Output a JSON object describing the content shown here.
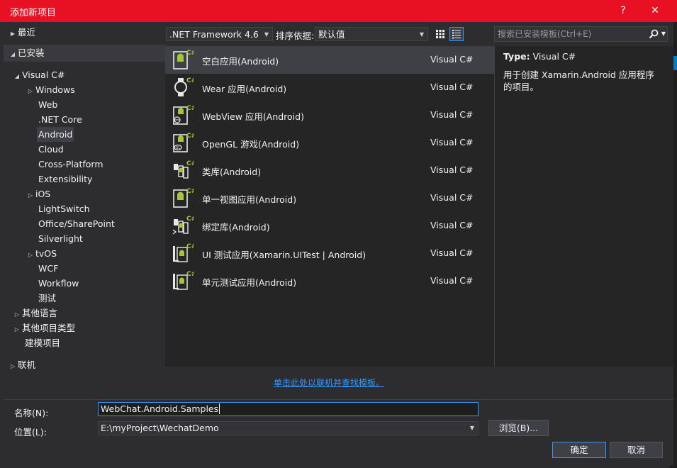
{
  "window": {
    "title": "添加新项目",
    "help_label": "?",
    "close_label": "✕"
  },
  "sidebar": {
    "recent": "最近",
    "installed": "已安装",
    "online": "联机",
    "visual_cs": "Visual C#",
    "items": [
      "Windows",
      "Web",
      ".NET Core",
      "Android",
      "Cloud",
      "Cross-Platform",
      "Extensibility",
      "iOS",
      "LightSwitch",
      "Office/SharePoint",
      "Silverlight",
      "tvOS",
      "WCF",
      "Workflow",
      "测试"
    ],
    "other_languages": "其他语言",
    "other_project_types": "其他项目类型",
    "modeling": "建模项目"
  },
  "toolbar": {
    "framework": ".NET Framework 4.6",
    "sort_label": "排序依据:",
    "sort_value": "默认值",
    "search_placeholder": "搜索已安装模板(Ctrl+E)"
  },
  "templates": [
    {
      "name": "空白应用(Android)",
      "lang": "Visual C#"
    },
    {
      "name": "Wear 应用(Android)",
      "lang": "Visual C#"
    },
    {
      "name": "WebView 应用(Android)",
      "lang": "Visual C#"
    },
    {
      "name": "OpenGL 游戏(Android)",
      "lang": "Visual C#"
    },
    {
      "name": "类库(Android)",
      "lang": "Visual C#"
    },
    {
      "name": "单一视图应用(Android)",
      "lang": "Visual C#"
    },
    {
      "name": "绑定库(Android)",
      "lang": "Visual C#"
    },
    {
      "name": "UI 测试应用(Xamarin.UITest | Android)",
      "lang": "Visual C#"
    },
    {
      "name": "单元测试应用(Android)",
      "lang": "Visual C#"
    }
  ],
  "description": {
    "type_label": "Type:",
    "type_value": "Visual C#",
    "text": "用于创建 Xamarin.Android 应用程序的项目。"
  },
  "online_link": "单击此处以联机并查找模板。",
  "form": {
    "name_label": "名称(N):",
    "name_value": "WebChat.Android.Samples",
    "location_label": "位置(L):",
    "location_value": "E:\\myProject\\WechatDemo",
    "browse_label": "浏览(B)...",
    "ok_label": "确定",
    "cancel_label": "取消"
  },
  "colors": {
    "titlebar": "#e81123",
    "accent": "#3399ff",
    "android_green": "#a4c639",
    "background": "#2d2d30"
  }
}
